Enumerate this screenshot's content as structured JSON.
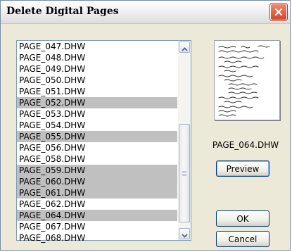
{
  "window": {
    "title": "Delete Digital Pages"
  },
  "file_list": {
    "items": [
      {
        "label": "PAGE_047.DHW",
        "selected": false
      },
      {
        "label": "PAGE_048.DHW",
        "selected": false
      },
      {
        "label": "PAGE_049.DHW",
        "selected": false
      },
      {
        "label": "PAGE_050.DHW",
        "selected": false
      },
      {
        "label": "PAGE_051.DHW",
        "selected": false
      },
      {
        "label": "PAGE_052.DHW",
        "selected": true
      },
      {
        "label": "PAGE_053.DHW",
        "selected": false
      },
      {
        "label": "PAGE_054.DHW",
        "selected": false
      },
      {
        "label": "PAGE_055.DHW",
        "selected": true
      },
      {
        "label": "PAGE_056.DHW",
        "selected": false
      },
      {
        "label": "PAGE_058.DHW",
        "selected": false
      },
      {
        "label": "PAGE_059.DHW",
        "selected": true
      },
      {
        "label": "PAGE_060.DHW",
        "selected": true
      },
      {
        "label": "PAGE_061.DHW",
        "selected": true
      },
      {
        "label": "PAGE_062.DHW",
        "selected": false
      },
      {
        "label": "PAGE_064.DHW",
        "selected": true
      },
      {
        "label": "PAGE_067.DHW",
        "selected": false
      },
      {
        "label": "PAGE_068.DHW",
        "selected": false
      }
    ]
  },
  "preview": {
    "filename": "PAGE_064.DHW",
    "preview_button": "Preview"
  },
  "buttons": {
    "ok": "OK",
    "cancel": "Cancel"
  },
  "colors": {
    "selection": "#c0c0c0",
    "dialog_bg": "#ece9d8",
    "close_button": "#d5452a"
  }
}
